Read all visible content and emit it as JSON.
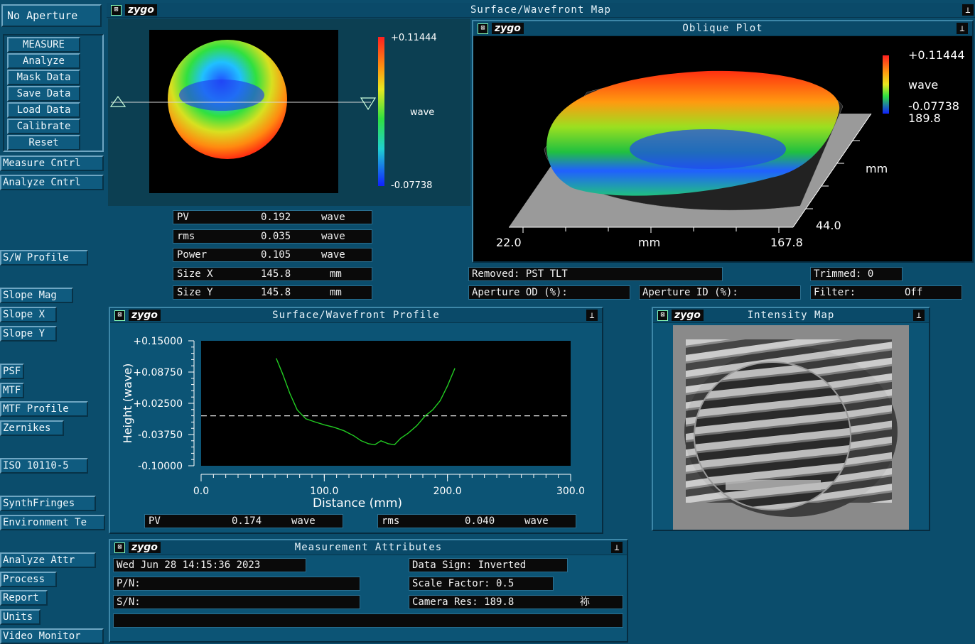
{
  "sidebar": {
    "no_aperture": "No Aperture",
    "main_buttons": [
      "MEASURE",
      "Analyze",
      "Mask Data",
      "Save Data",
      "Load Data",
      "Calibrate",
      "Reset"
    ],
    "measure_cntrl": "Measure Cntrl",
    "analyze_cntrl": "Analyze Cntrl",
    "sw_profile": "S/W Profile",
    "slope_mag": "Slope Mag",
    "slope_x": "Slope X",
    "slope_y": "Slope Y",
    "psf": "PSF",
    "mtf": "MTF",
    "mtf_profile": "MTF Profile",
    "zernikes": "Zernikes",
    "iso": "ISO 10110-5",
    "synth_fringes": "SynthFringes",
    "environment": "Environment Te",
    "analyze_attr": "Analyze Attr",
    "process": "Process",
    "report": "Report",
    "units": "Units",
    "video_monitor": "Video Monitor"
  },
  "logo": "zygo",
  "surface_map": {
    "title": "Surface/Wavefront Map",
    "scale_max": "+0.11444",
    "scale_min": "-0.07738",
    "scale_unit": "wave"
  },
  "oblique_plot": {
    "title": "Oblique Plot",
    "scale_max": "+0.11444",
    "scale_min": "-0.07738",
    "scale_unit": "wave",
    "extra_value": "189.8",
    "y_label": "mm",
    "y_value": "44.0",
    "x_min": "22.0",
    "x_label": "mm",
    "x_max": "167.8"
  },
  "stats": [
    {
      "label": "PV",
      "value": "0.192",
      "unit": "wave"
    },
    {
      "label": "rms",
      "value": "0.035",
      "unit": "wave"
    },
    {
      "label": "Power",
      "value": "0.105",
      "unit": "wave"
    },
    {
      "label": "Size X",
      "value": "145.8",
      "unit": "mm"
    },
    {
      "label": "Size Y",
      "value": "145.8",
      "unit": "mm"
    }
  ],
  "info_fields": {
    "removed": "Removed: PST TLT",
    "trimmed": "Trimmed:  0",
    "aperture_od": "Aperture OD (%):",
    "aperture_id": "Aperture ID (%):",
    "filter_label": "Filter:",
    "filter_value": "Off"
  },
  "profile": {
    "title": "Surface/Wavefront Profile",
    "pv_label": "PV",
    "pv_value": "0.174",
    "pv_unit": "wave",
    "rms_label": "rms",
    "rms_value": "0.040",
    "rms_unit": "wave"
  },
  "chart_data": {
    "type": "line",
    "title": "",
    "xlabel": "Distance (mm)",
    "ylabel": "Height (wave)",
    "xlim": [
      0,
      300
    ],
    "ylim": [
      -0.1,
      0.15
    ],
    "x_tick_labels": [
      "0.0",
      "100.0",
      "200.0",
      "300.0"
    ],
    "y_tick_labels": [
      "+0.15000",
      "+0.08750",
      "+0.02500",
      "-0.03750",
      "-0.10000"
    ],
    "reference_line_y": 0.0,
    "series": [
      {
        "x": [
          61,
          66,
          72,
          78,
          85,
          92,
          100,
          108,
          116,
          124,
          130,
          136,
          141,
          146,
          152,
          157,
          162,
          168,
          175,
          182,
          188,
          194,
          200,
          206
        ],
        "y": [
          0.115,
          0.085,
          0.045,
          0.012,
          -0.006,
          -0.012,
          -0.018,
          -0.023,
          -0.03,
          -0.04,
          -0.05,
          -0.056,
          -0.058,
          -0.05,
          -0.056,
          -0.058,
          -0.045,
          -0.035,
          -0.02,
          0.0,
          0.012,
          0.03,
          0.06,
          0.095
        ]
      }
    ],
    "color": "#22cc22"
  },
  "intensity_map": {
    "title": "Intensity Map"
  },
  "attributes": {
    "title": "Measurement Attributes",
    "datetime": "Wed Jun 28 14:15:36 2023",
    "pn": "P/N:",
    "sn": "S/N:",
    "data_sign": "Data Sign:  Inverted",
    "scale_factor": "Scale Factor:  0.5",
    "camera_res": "Camera Res:  189.8",
    "camera_unit": "袮"
  },
  "colors": {
    "background": "#0b4d6c",
    "trace": "#22cc22"
  }
}
